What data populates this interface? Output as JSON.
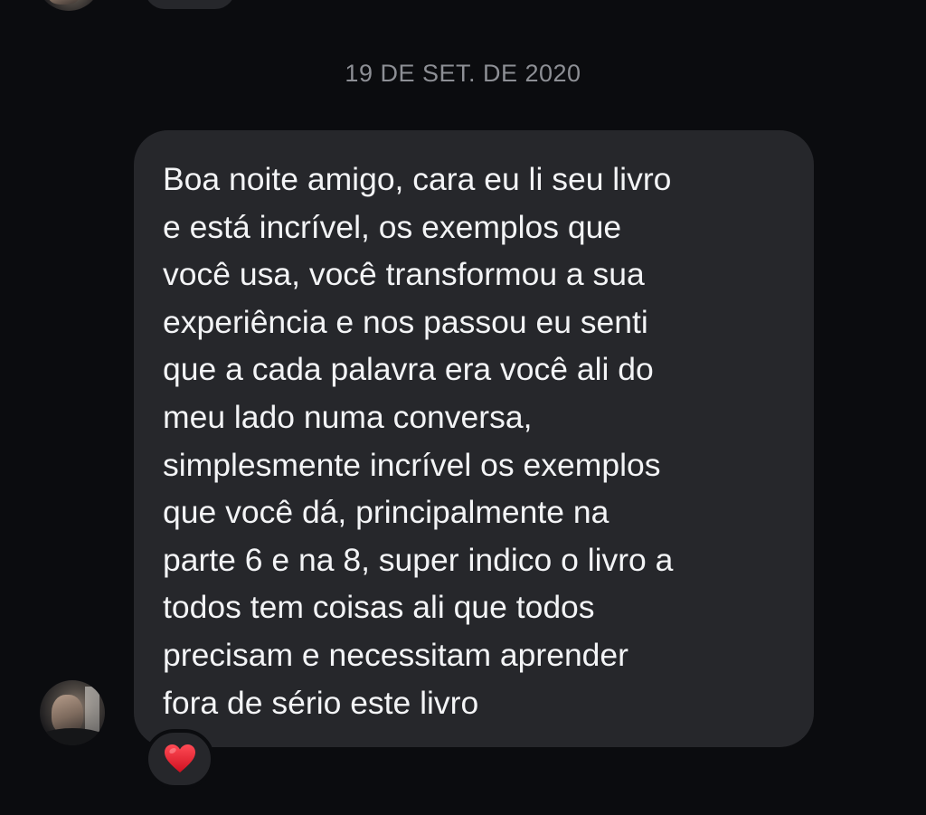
{
  "conversation": {
    "date_separator": "19 DE SET. DE 2020",
    "message": {
      "text": "Boa noite amigo, cara eu li seu livro\ne está incrível, os exemplos que\nvocê usa, você transformou a sua\nexperiência e nos passou eu senti\nque a cada palavra era você ali do\nmeu lado numa conversa,\nsimplesmente incrível os exemplos\nque você dá, principalmente na\nparte 6 e na 8, super indico o livro a\ntodos tem coisas ali que todos\nprecisam e necessitam aprender\nfora de sério este livro",
      "reaction": "heart-icon"
    }
  },
  "colors": {
    "background": "#0b0c0f",
    "bubble": "#26272b",
    "message_text": "#f3f4f6",
    "date_text": "#8d8f95",
    "reaction_heart": "#e0192a"
  }
}
